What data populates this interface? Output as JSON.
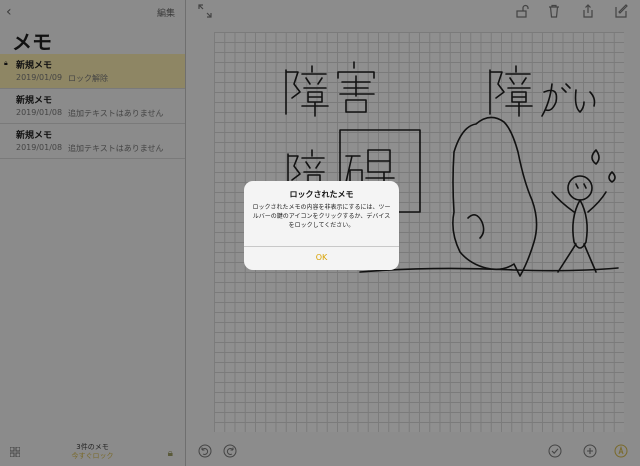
{
  "sidebar": {
    "back_icon": "chevron-left-icon",
    "edit_label": "編集",
    "title": "メモ",
    "notes": [
      {
        "title": "新規メモ",
        "date": "2019/01/09",
        "subtitle": "ロック解除",
        "locked": true,
        "selected": true
      },
      {
        "title": "新規メモ",
        "date": "2019/01/08",
        "subtitle": "追加テキストはありません"
      },
      {
        "title": "新規メモ",
        "date": "2019/01/08",
        "subtitle": "追加テキストはありません"
      }
    ],
    "count_label": "3件のメモ",
    "lock_now_label": "今すぐロック",
    "accent_color": "#d9a200"
  },
  "toolbar": {
    "icons": [
      "expand-icon",
      "lock-open-icon",
      "trash-icon",
      "share-icon",
      "compose-icon"
    ]
  },
  "bottom_toolbar": {
    "icons": [
      "undo-icon",
      "redo-icon",
      "checklist-icon",
      "add-icon",
      "markup-pen-icon"
    ]
  },
  "dialog": {
    "title": "ロックされたメモ",
    "message": "ロックされたメモの内容を非表示にするには、ツールバーの鍵のアイコンをクリックするか、デバイスをロックしてください。",
    "ok_label": "OK"
  }
}
